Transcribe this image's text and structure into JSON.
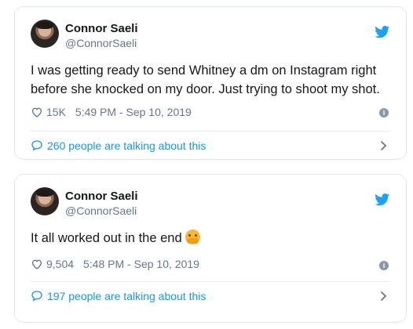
{
  "tweets": [
    {
      "display_name": "Connor Saeli",
      "handle": "@ConnorSaeli",
      "text": "I was getting ready to send Whitney a dm on Instagram right before she knocked on my door. Just trying to shoot my shot.",
      "likes": "15K",
      "timestamp": "5:49 PM - Sep 10, 2019",
      "talking": "260 people are talking about this"
    },
    {
      "display_name": "Connor Saeli",
      "handle": "@ConnorSaeli",
      "text": "It all worked out in the end",
      "likes": "9,504",
      "timestamp": "5:48 PM - Sep 10, 2019",
      "talking": "197 people are talking about this"
    }
  ],
  "icons": {
    "brand": "twitter-bird-icon",
    "like": "heart-icon",
    "info": "info-icon",
    "conversation": "speech-bubble-icon",
    "expand": "chevron-right-icon",
    "emoji": "hugging-face-emoji"
  },
  "colors": {
    "accent": "#1b95e0",
    "twitter_blue": "#1da1f2",
    "muted_text": "#657786",
    "border": "#e1e8ed"
  }
}
